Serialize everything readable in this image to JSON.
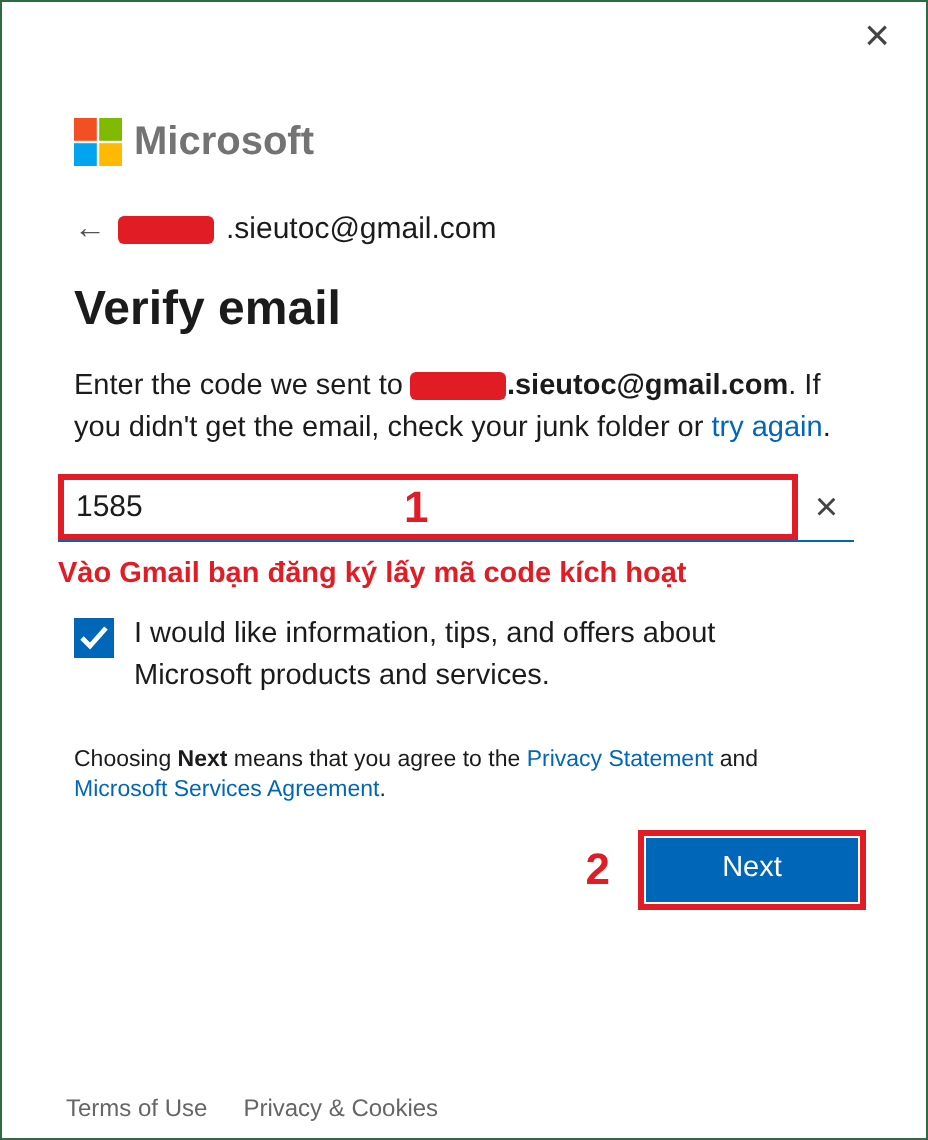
{
  "window": {
    "close": "×"
  },
  "brand": {
    "name": "Microsoft"
  },
  "back": {
    "arrow": "←",
    "email": ".sieutoc@gmail.com",
    "redacted": true
  },
  "title": "Verify email",
  "intro": {
    "before": "Enter the code we sent to ",
    "email": ".sieutoc@gmail.com",
    "redacted": true,
    "after": ". If you didn't get the email, check your junk folder or ",
    "link": "try again",
    "end": "."
  },
  "code_field": {
    "value": "1585",
    "clear": "×"
  },
  "marketing": {
    "label": "I would like information, tips, and offers about Microsoft products and services.",
    "checked": true
  },
  "agreement": {
    "text": "Choosing **Next** means that you agree to the ",
    "link_1": "Privacy Statement",
    "middle": " and ",
    "link_2": "Microsoft Services Agreement",
    "end": "."
  },
  "next_button": "Next",
  "annotations": [
    {
      "kind": "number",
      "text": "1"
    },
    {
      "kind": "note",
      "text": "Vào Gmail bạn đăng ký lấy mã code kích hoạt"
    },
    {
      "kind": "number",
      "text": "2"
    }
  ],
  "footer": [
    "Terms of Use",
    "Privacy & Cookies"
  ]
}
